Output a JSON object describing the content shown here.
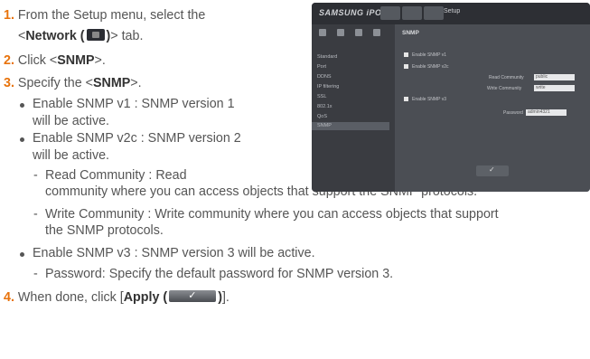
{
  "steps": [
    {
      "num": "1.",
      "pre": "From the Setup menu, select the",
      "line2_pre": "<",
      "tab_bold": "Network (",
      "tab_close": ")",
      "line2_post": "> tab."
    },
    {
      "num": "2.",
      "pre": "Click <",
      "bold": "SNMP",
      "post": ">."
    },
    {
      "num": "3.",
      "pre": "Specify the <",
      "bold": "SNMP",
      "post": ">."
    },
    {
      "num": "4.",
      "pre": "When done, click [",
      "bold": "Apply (",
      "bold_close": ")",
      "post": "]."
    }
  ],
  "bullets": [
    {
      "line1": "Enable SNMP v1 : SNMP version 1",
      "line2": "will be active."
    },
    {
      "line1": "Enable SNMP v2c : SNMP version 2",
      "line2": "will be active."
    },
    {
      "line1": "Enable SNMP v3 : SNMP version 3 will be active."
    }
  ],
  "dashes": [
    {
      "line1": "Read Community : Read",
      "line2": "community where you can access objects that support the SNMP protocols."
    },
    {
      "line1": "Write Community : Write community where you can access objects that support",
      "line2": "the SNMP protocols."
    },
    {
      "line1": "Password: Specify the default password for SNMP version 3."
    }
  ],
  "screenshot": {
    "logo": "SAMSUNG iPOLiS",
    "setup_label": "Setup",
    "section_title": "SNMP",
    "sidebar_items": [
      "Standard",
      "Port",
      "DDNS",
      "IP filtering",
      "SSL",
      "802.1x",
      "QoS",
      "SNMP"
    ],
    "active_index": 7,
    "options": [
      "Enable SNMP v1",
      "Enable SNMP v2c",
      "Enable SNMP v3"
    ],
    "read_community_label": "Read Community",
    "read_community_value": "public",
    "write_community_label": "Write Community",
    "write_community_value": "write",
    "password_label": "Password",
    "password_value": "admin4321",
    "colors": {
      "frame": "#43464c",
      "topbar": "#2d2f34",
      "sidebar": "#3a3c41",
      "content": "#4b4e54",
      "step_number": "#e8730c"
    }
  }
}
